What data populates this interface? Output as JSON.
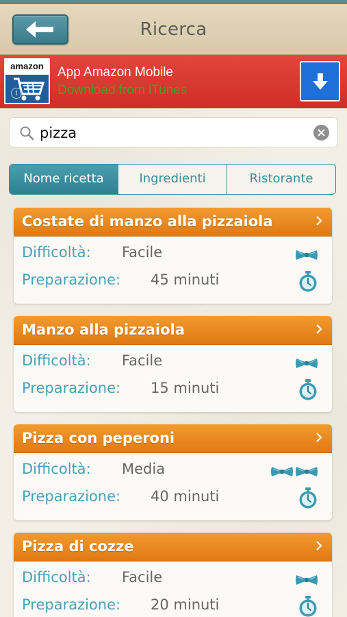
{
  "header": {
    "title": "Ricerca",
    "back_icon": "arrow-left-icon"
  },
  "ad": {
    "logo_text": "amazon",
    "title": "App Amazon Mobile",
    "subtitle": "Download from iTunes",
    "info_glyph": "i",
    "download_icon": "download-arrow-icon"
  },
  "search": {
    "value": "pizza",
    "search_icon": "search-icon",
    "clear_icon": "clear-icon"
  },
  "tabs": [
    {
      "label": "Nome ricetta",
      "active": true
    },
    {
      "label": "Ingredienti",
      "active": false
    },
    {
      "label": "Ristorante",
      "active": false
    }
  ],
  "labels": {
    "difficulty": "Difficoltà:",
    "preparation": "Preparazione:"
  },
  "recipes": [
    {
      "title": "Costate di manzo alla pizzaiola",
      "difficulty": "Facile",
      "difficulty_level": 1,
      "time": "45 minuti"
    },
    {
      "title": "Manzo alla pizzaiola",
      "difficulty": "Facile",
      "difficulty_level": 1,
      "time": "15 minuti"
    },
    {
      "title": "Pizza con peperoni",
      "difficulty": "Media",
      "difficulty_level": 2,
      "time": "40 minuti"
    },
    {
      "title": "Pizza di cozze",
      "difficulty": "Facile",
      "difficulty_level": 1,
      "time": "20 minuti"
    }
  ],
  "colors": {
    "accent": "#3a8a98",
    "card_header": "#e8861f",
    "label": "#4aa0b5",
    "ad_background": "#d6342c"
  }
}
